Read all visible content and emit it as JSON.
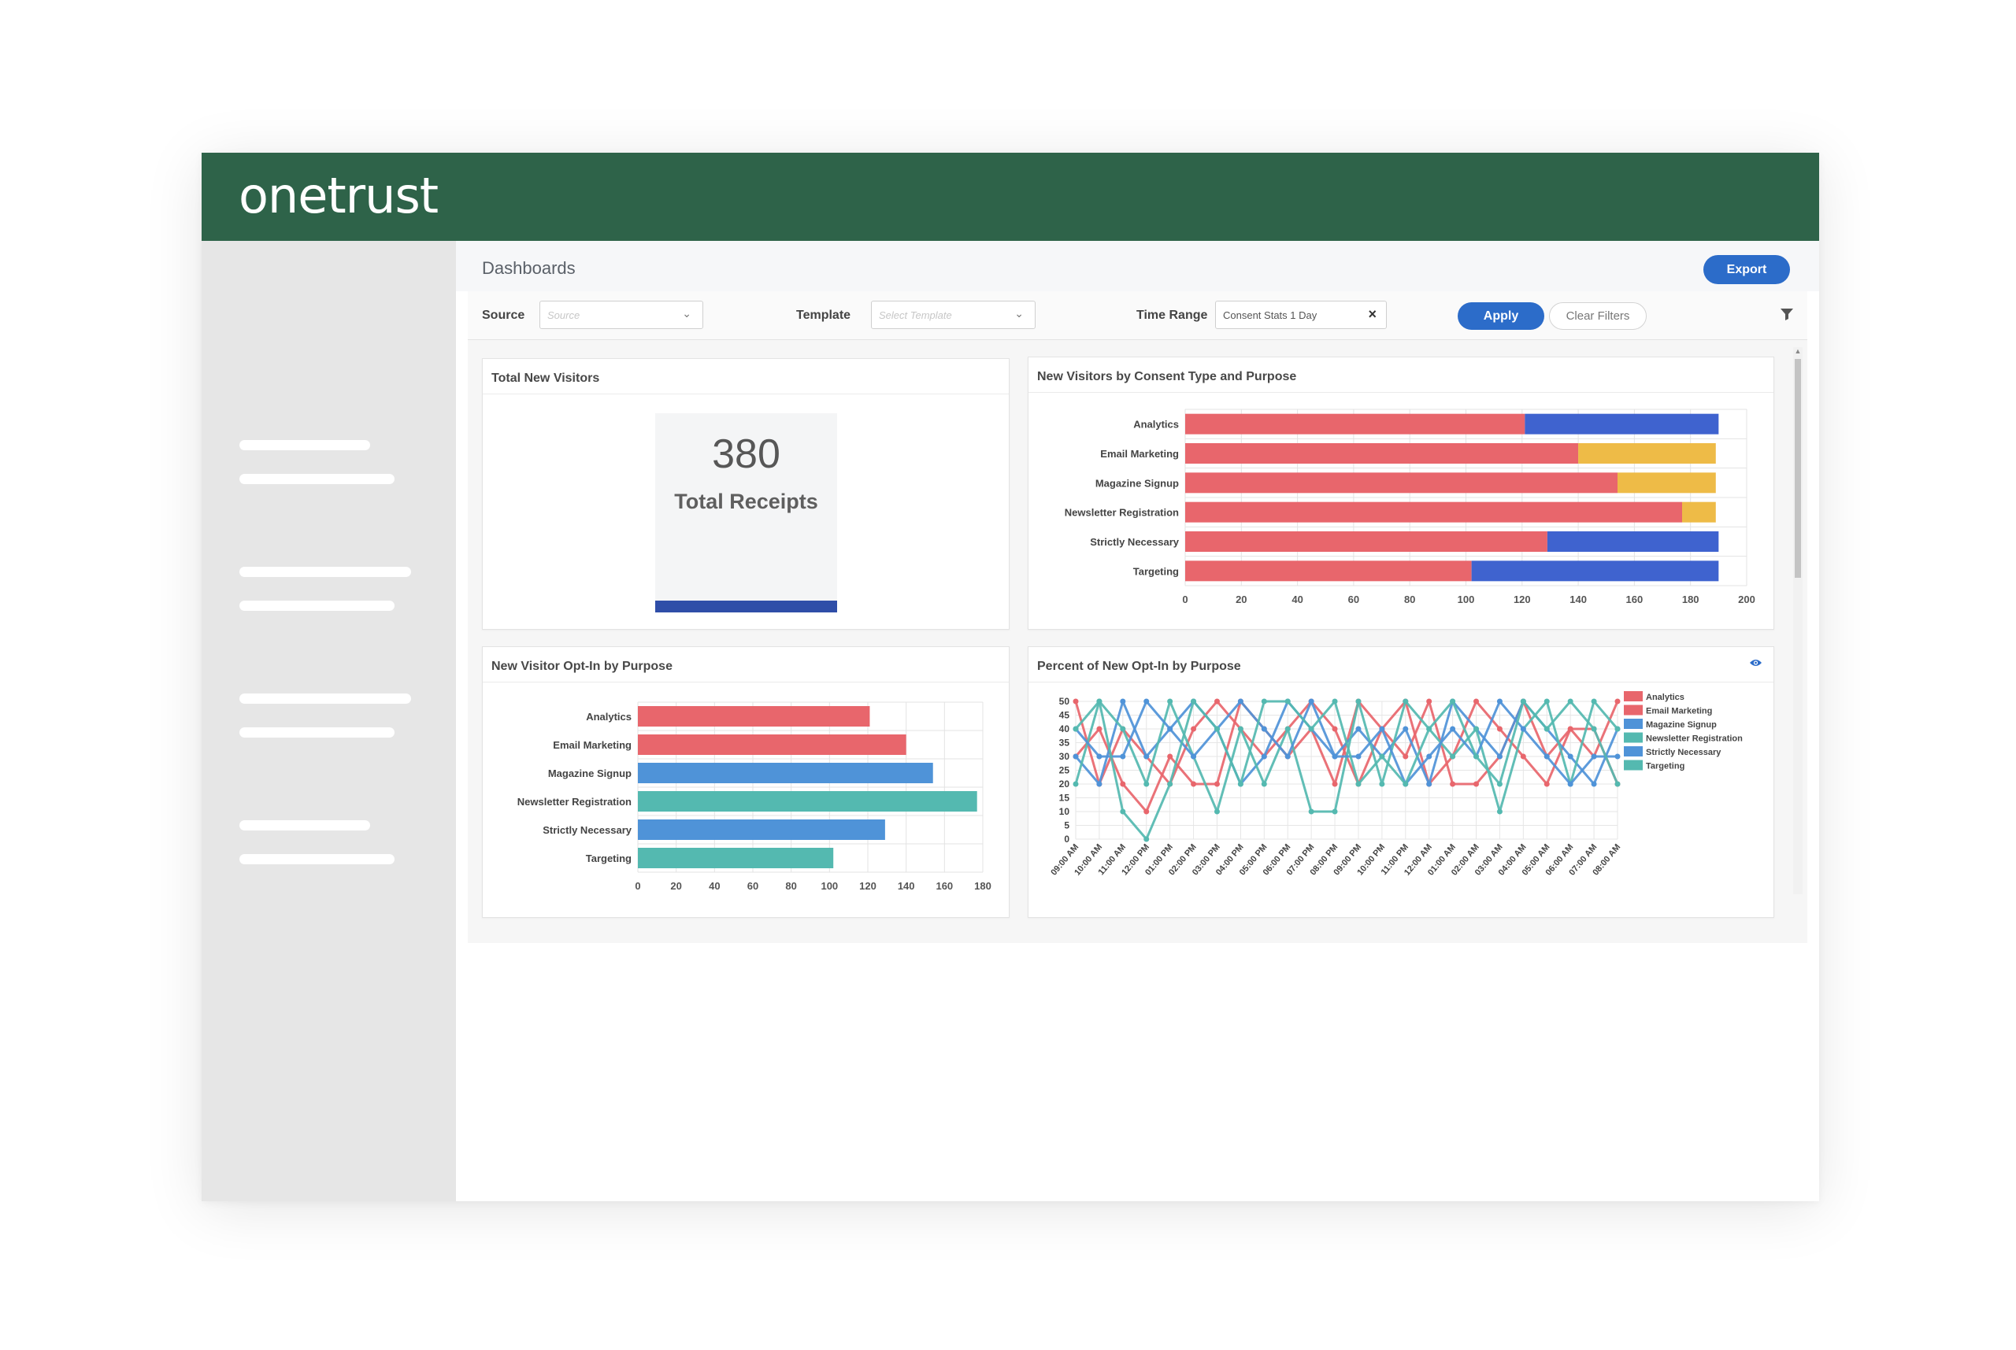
{
  "app": {
    "logo": "onetrust"
  },
  "page": {
    "title": "Dashboards",
    "export_label": "Export"
  },
  "filters": {
    "source_label": "Source",
    "source_placeholder": "Source",
    "template_label": "Template",
    "template_placeholder": "Select Template",
    "time_range_label": "Time Range",
    "time_range_value": "Consent Stats 1 Day",
    "apply_label": "Apply",
    "clear_label": "Clear Filters"
  },
  "colors": {
    "header": "#2e6349",
    "primary": "#2c6cc9",
    "red": "#e8666c",
    "blue": "#3f63cf",
    "yellow": "#eebb47",
    "lightblue": "#4f93d8",
    "teal": "#54b9b0"
  },
  "cards": {
    "total": {
      "title": "Total New Visitors",
      "value": "380",
      "label": "Total Receipts"
    },
    "consent_type": {
      "title": "New Visitors by Consent Type and Purpose"
    },
    "opt_in": {
      "title": "New Visitor Opt-In by Purpose"
    },
    "percent": {
      "title": "Percent of New Opt-In by Purpose"
    }
  },
  "chart_data": [
    {
      "type": "bar",
      "orientation": "horizontal",
      "stacked": true,
      "title": "New Visitors by Consent Type and Purpose",
      "categories": [
        "Analytics",
        "Email Marketing",
        "Magazine Signup",
        "Newsletter Registration",
        "Strictly Necessary",
        "Targeting"
      ],
      "segments": [
        {
          "values": [
            121,
            140,
            154,
            177,
            129,
            102
          ],
          "color": "#e8666c"
        },
        {
          "values": [
            69,
            49,
            35,
            12,
            61,
            88
          ],
          "colors": [
            "#3f63cf",
            "#eebb47",
            "#eebb47",
            "#eebb47",
            "#3f63cf",
            "#3f63cf"
          ]
        }
      ],
      "xlim": [
        0,
        200
      ],
      "xticks": [
        "0",
        "20",
        "40",
        "60",
        "80",
        "100",
        "120",
        "140",
        "160",
        "180",
        "200"
      ],
      "grid": true
    },
    {
      "type": "bar",
      "orientation": "horizontal",
      "title": "New Visitor Opt-In by Purpose",
      "categories": [
        "Analytics",
        "Email Marketing",
        "Magazine Signup",
        "Newsletter Registration",
        "Strictly Necessary",
        "Targeting"
      ],
      "values": [
        121,
        140,
        154,
        177,
        129,
        102
      ],
      "colors": [
        "#e8666c",
        "#e8666c",
        "#4f93d8",
        "#54b9b0",
        "#4f93d8",
        "#54b9b0"
      ],
      "xlim": [
        0,
        180
      ],
      "xticks": [
        "0",
        "20",
        "40",
        "60",
        "80",
        "100",
        "120",
        "140",
        "160",
        "180"
      ],
      "grid": true
    },
    {
      "type": "line",
      "title": "Percent of New Opt-In by Purpose",
      "x": [
        "09:00 AM",
        "10:00 AM",
        "11:00 AM",
        "12:00 PM",
        "01:00 PM",
        "02:00 PM",
        "03:00 PM",
        "04:00 PM",
        "05:00 PM",
        "06:00 PM",
        "07:00 PM",
        "08:00 PM",
        "09:00 PM",
        "10:00 PM",
        "11:00 PM",
        "12:00 AM",
        "01:00 AM",
        "02:00 AM",
        "03:00 AM",
        "04:00 AM",
        "05:00 AM",
        "06:00 AM",
        "07:00 AM",
        "08:00 AM"
      ],
      "ylim": [
        0,
        50
      ],
      "yticks": [
        "0",
        "5",
        "10",
        "15",
        "20",
        "25",
        "30",
        "35",
        "40",
        "45",
        "50"
      ],
      "legend_position": "right",
      "grid": true,
      "series": [
        {
          "name": "Analytics",
          "color": "#e8666c",
          "values": [
            50,
            20,
            40,
            30,
            20,
            40,
            50,
            40,
            30,
            40,
            50,
            40,
            20,
            40,
            50,
            20,
            30,
            50,
            40,
            30,
            20,
            40,
            30,
            50
          ]
        },
        {
          "name": "Email Marketing",
          "color": "#e8666c",
          "values": [
            30,
            40,
            20,
            10,
            30,
            20,
            20,
            50,
            40,
            30,
            40,
            20,
            50,
            40,
            30,
            50,
            20,
            20,
            30,
            50,
            30,
            40,
            40,
            20
          ]
        },
        {
          "name": "Magazine Signup",
          "color": "#4f93d8",
          "values": [
            30,
            20,
            50,
            30,
            40,
            50,
            40,
            20,
            30,
            50,
            40,
            30,
            40,
            30,
            40,
            20,
            50,
            40,
            30,
            50,
            40,
            30,
            20,
            40
          ]
        },
        {
          "name": "Newsletter Registration",
          "color": "#54b9b0",
          "values": [
            20,
            50,
            40,
            20,
            50,
            30,
            10,
            40,
            20,
            40,
            10,
            10,
            50,
            20,
            50,
            40,
            30,
            40,
            10,
            40,
            50,
            20,
            50,
            40
          ]
        },
        {
          "name": "Strictly Necessary",
          "color": "#4f93d8",
          "values": [
            40,
            30,
            30,
            50,
            40,
            30,
            40,
            50,
            40,
            30,
            50,
            30,
            30,
            40,
            20,
            30,
            40,
            30,
            50,
            40,
            30,
            20,
            30,
            30
          ]
        },
        {
          "name": "Targeting",
          "color": "#54b9b0",
          "values": [
            40,
            50,
            10,
            0,
            20,
            50,
            40,
            20,
            50,
            50,
            40,
            50,
            20,
            30,
            20,
            40,
            50,
            30,
            20,
            50,
            40,
            50,
            40,
            20
          ]
        }
      ]
    }
  ]
}
